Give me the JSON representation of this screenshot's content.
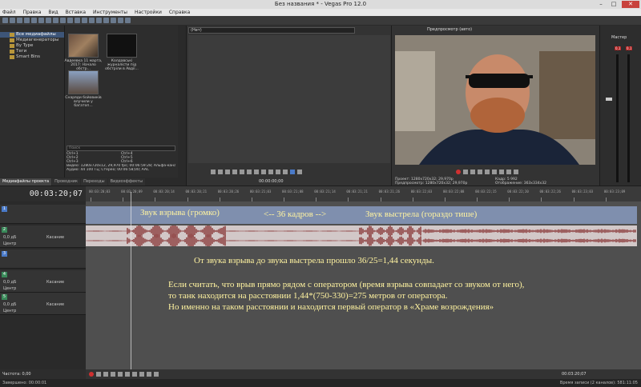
{
  "window": {
    "title": "Без названия * - Vegas Pro 12.0",
    "min": "–",
    "max": "□",
    "close": "✕"
  },
  "menu": [
    "Файл",
    "Правка",
    "Вид",
    "Вставка",
    "Инструменты",
    "Настройки",
    "Справка"
  ],
  "explorer": {
    "tree": [
      "Все медиафайлы",
      "Медиагенераторы",
      "By Type",
      "Теги",
      "Smart Bins"
    ],
    "thumbs": [
      {
        "label": "Авдеевка 11 марта, 2017: Начало обстр..."
      },
      {
        "label": "Колдавські журналісти під обстріли в Авдії..."
      },
      {
        "label": "Снаряди бойовиків влучили у багатоп..."
      }
    ],
    "search_placeholder": "Поиск",
    "shortcuts": [
      "Ctrl+1",
      "Ctrl+4",
      "Ctrl+2",
      "Ctrl+5",
      "Ctrl+3",
      "Ctrl+6"
    ],
    "props_video": "Видео: 1280x720x12, 29,970 fps; 00:06:59:28; Альфа-канал = Отсу",
    "props_audio": "Аудио: 44 100 Гц; Стерео; 00:06:58;00; AAC"
  },
  "tabs": [
    "Медиафайлы проекта",
    "Проводник",
    "Переходы",
    "Видеоэффекты"
  ],
  "trimmer": {
    "dropdown": "(Нет)",
    "timecode": "00:00:00;00"
  },
  "preview": {
    "mode": "Предпросмотр (авто)",
    "info": [
      "Проект: 1280x720x32; 29,970p",
      "Кадр: 5 992",
      "Предпросмотр: 1280x720x32; 29,970p",
      "Отображение: 363x334x32"
    ]
  },
  "mixer": {
    "title": "Мастер",
    "left_level": "0,1",
    "right_level": "0,1"
  },
  "timeline": {
    "timecode": "00:03:20;07",
    "ruler": [
      "00:03:20;03",
      "00:03:20;09",
      "00:03:20;14",
      "00:03:20;21",
      "00:03:20;26",
      "00:03:21;03",
      "00:03:21;08",
      "00:03:21;14",
      "00:03:21;21",
      "00:03:21;26",
      "00:03:22;03",
      "00:03:22;08",
      "00:03:22;15",
      "00:03:22;20",
      "00:03:22;26",
      "00:03:23;03",
      "00:03:23;09"
    ],
    "tracks": [
      {
        "num": "1",
        "type": "video"
      },
      {
        "num": "2",
        "type": "audio",
        "level": "0,0 дБ",
        "mode": "Касание",
        "pan": "Центр"
      },
      {
        "num": "3",
        "type": "video"
      },
      {
        "num": "4",
        "type": "audio",
        "level": "0,0 дБ",
        "mode": "Касание",
        "pan": "Центр"
      },
      {
        "num": "5",
        "type": "audio",
        "level": "0,0 дБ",
        "mode": "Касание",
        "pan": "Центр"
      }
    ]
  },
  "annotations": {
    "explosion": "Звук взрыва (громко)",
    "frames": "<-- 36 кадров -->",
    "shot": "Звук выстрела (гораздо тише)",
    "line1": "От звука взрыва до звука выстрела прошло 36/25=1,44 секунды.",
    "line2": "Если считать, что врыв прямо рядом с оператором (время взрыва совпадает со звуком от него),",
    "line3": "то танк находится на расстоянии 1,44*(750-330)=275 метров от оператора.",
    "line4": "Но именно на таком расстоянии и находится первый оператор в «Храме возрождения»"
  },
  "bottom": {
    "rate": "Частота: 0,00",
    "timecode": "00:03:20;07"
  },
  "status": {
    "left": "Завершено: 00:00:01",
    "right": "Время записи (2 каналов): 581:11:05"
  }
}
